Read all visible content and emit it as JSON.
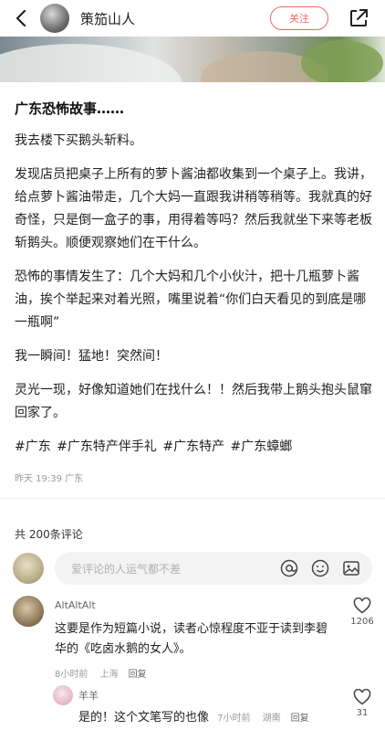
{
  "header": {
    "author": "策笳山人",
    "follow_label": "关注"
  },
  "post": {
    "title": "广东恐怖故事……",
    "paragraphs": [
      "我去楼下买鹅头斩料。",
      "发现店员把桌子上所有的萝卜酱油都收集到一个桌子上。我讲，给点萝卜酱油带走，几个大妈一直跟我讲稍等稍等。我就真的好奇怪，只是倒一盒子的事，用得着等吗？然后我就坐下来等老板斩鹅头。顺便观察她们在干什么。",
      "恐怖的事情发生了：几个大妈和几个小伙汁，把十几瓶萝卜酱油，挨个举起来对着光照，嘴里说着“你们白天看见的到底是哪一瓶啊”",
      "我一瞬间！猛地！突然间！",
      "灵光一现，好像知道她们在找什么！！然后我带上鹅头抱头鼠窜回家了。"
    ],
    "tags": "#广东 #广东特产伴手礼 #广东特产 #广东蟑螂",
    "meta": "昨天 19:39 广东"
  },
  "comments_section": {
    "count_label": "共 200条评论",
    "input_placeholder": "爱评论的人运气都不差"
  },
  "comments": [
    {
      "name": "AltAltAlt",
      "text": "这要是作为短篇小说，读者心惊程度不亚于读到李碧华的《吃卤水鹅的女人》。",
      "time": "8小时前",
      "location": "上海",
      "reply": "回复",
      "likes": "1206"
    },
    {
      "name": "羊羊",
      "text": "是的！这个文笔写的也像",
      "time": "7小时前",
      "location": "湖南",
      "reply": "回复",
      "likes": "31"
    }
  ]
}
